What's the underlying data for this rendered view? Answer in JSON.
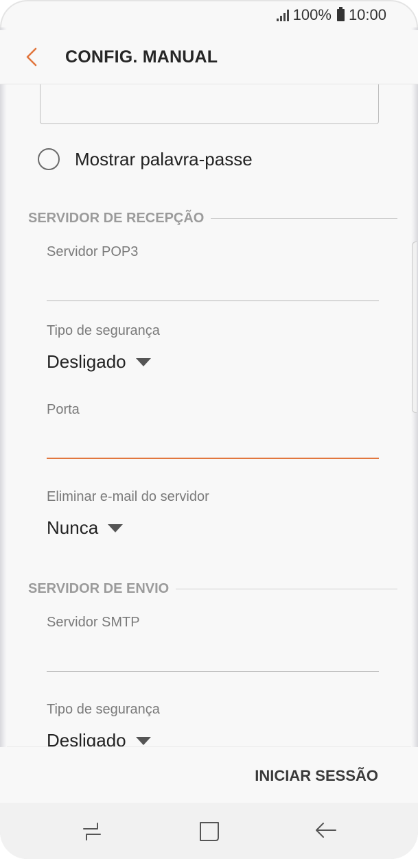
{
  "status_bar": {
    "battery": "100%",
    "time": "10:00",
    "signal_icon": "signal-icon",
    "battery_icon": "battery-icon"
  },
  "app_bar": {
    "title": "CONFIG. MANUAL",
    "back_icon": "chevron-left-icon",
    "accent": "#e1773f"
  },
  "show_password": {
    "label": "Mostrar palavra-passe",
    "checked": false
  },
  "incoming": {
    "section_title": "SERVIDOR DE RECEPÇÃO",
    "server_label": "Servidor POP3",
    "server_value": "",
    "security_label": "Tipo de segurança",
    "security_value": "Desligado",
    "port_label": "Porta",
    "port_value": "",
    "delete_label": "Eliminar e-mail do servidor",
    "delete_value": "Nunca"
  },
  "outgoing": {
    "section_title": "SERVIDOR DE ENVIO",
    "server_label": "Servidor SMTP",
    "server_value": "",
    "security_label": "Tipo de segurança",
    "security_value": "Desligado"
  },
  "actions": {
    "login_label": "INICIAR SESSÃO"
  },
  "nav_bar": {
    "recent_icon": "recent-apps-icon",
    "home_icon": "home-icon",
    "back_icon": "back-arrow-icon"
  }
}
